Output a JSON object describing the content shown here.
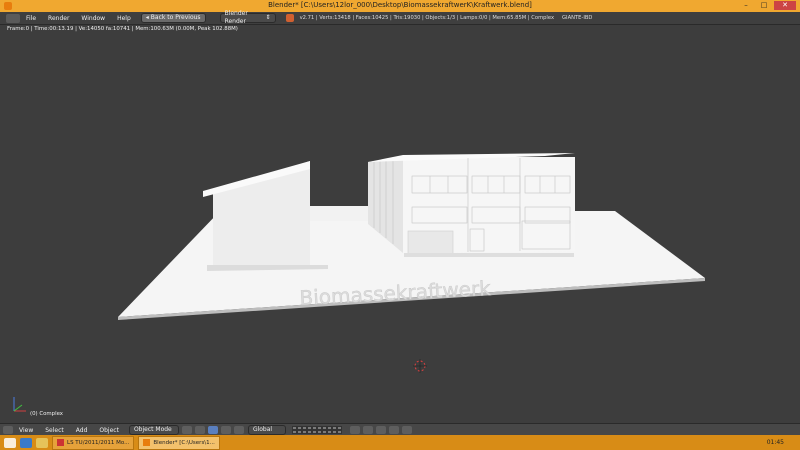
{
  "window": {
    "title": "Blender* [C:\\Users\\12lor_000\\Desktop\\BiomassekraftwerK\\Kraftwerk.blend]"
  },
  "menu": [
    "File",
    "Render",
    "Window",
    "Help"
  ],
  "info_header": {
    "back_button": "Back to Previous",
    "render_engine": "Blender Render",
    "stats": "v2.71 | Verts:13418 | Faces:10425 | Tris:19030 | Objects:1/3 | Lamps:0/0 | Mem:65.85M | Complex",
    "extra": "GIANTE-IBD"
  },
  "viewport": {
    "info": "Frame:0 | Time:00:13.19 | Ve:14050 fa:10741 | Mem:100.63M (0.00M, Peak 102.88M)",
    "object_label": "(0) Complex",
    "scene_text": "Biomassekraftwerk"
  },
  "header": {
    "view": "View",
    "select": "Select",
    "add": "Add",
    "object": "Object",
    "mode": "Object Mode",
    "orientation": "Global"
  },
  "taskbar": {
    "items": [
      "LS TU/2011/2011 Mo...",
      "Blender* [C:\\Users\\1..."
    ],
    "clock": "01:45"
  }
}
